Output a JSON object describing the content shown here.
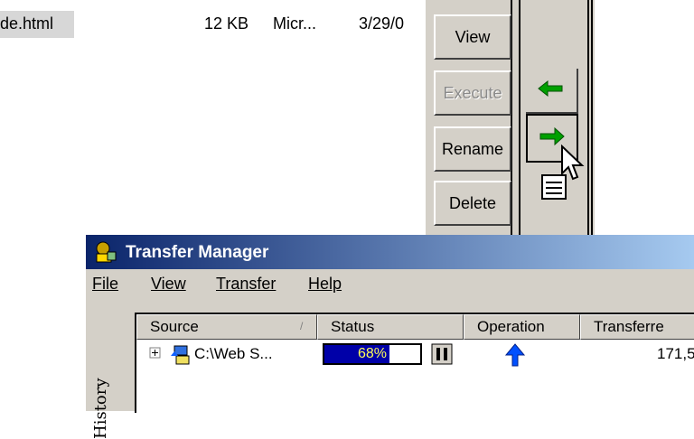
{
  "file_row": {
    "name": "de.html",
    "size": "12 KB",
    "type": "Micr...",
    "date": "3/29/0"
  },
  "buttons": [
    {
      "label": "View",
      "enabled": true
    },
    {
      "label": "Execute",
      "enabled": false
    },
    {
      "label": "Rename",
      "enabled": true
    },
    {
      "label": "Delete",
      "enabled": true
    }
  ],
  "arrows": {
    "left": "green-left-arrow-icon",
    "right": "green-right-arrow-icon",
    "extra": "queue-icon",
    "accent": "#00a000"
  },
  "transfer_manager": {
    "title": "Transfer Manager",
    "menu": [
      "File",
      "View",
      "Transfer",
      "Help"
    ],
    "side_label": "History",
    "columns": [
      "Source",
      "Status",
      "Operation",
      "Transferre"
    ],
    "rows": [
      {
        "source": "C:\\Web S...",
        "status_percent": "68%",
        "progress": 0.68,
        "transferred": "171,5"
      }
    ],
    "title_color": "#0a246a"
  }
}
